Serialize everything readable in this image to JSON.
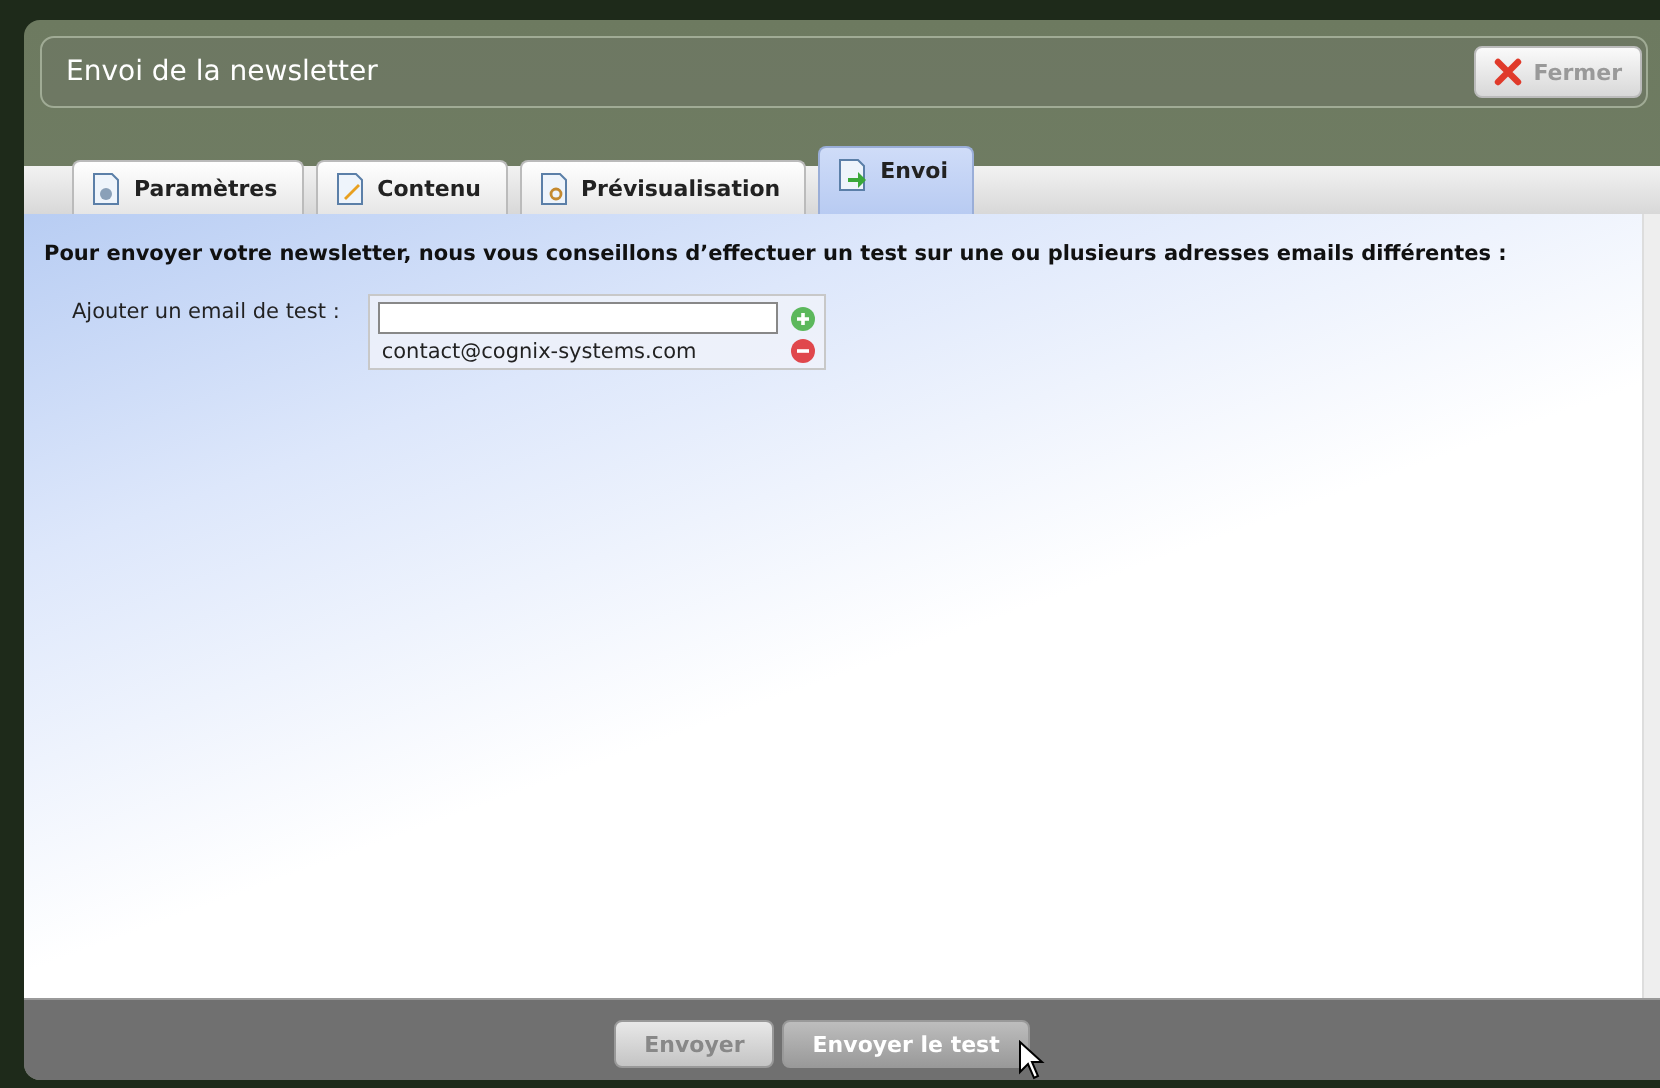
{
  "window": {
    "title": "Envoi de la newsletter",
    "close_button": "Fermer"
  },
  "tabs": [
    {
      "label": "Paramètres",
      "selected": false,
      "kind": "settings"
    },
    {
      "label": "Contenu",
      "selected": false,
      "kind": "edit"
    },
    {
      "label": "Prévisualisation",
      "selected": false,
      "kind": "preview"
    },
    {
      "label": "Envoi",
      "selected": true,
      "kind": "send"
    }
  ],
  "intro": "Pour envoyer votre newsletter, nous vous conseillons d’effectuer un test sur une ou plusieurs adresses emails différentes :",
  "test_email": {
    "label": "Ajouter un email de test :",
    "emails": [
      "contact@cognix-systems.com"
    ]
  },
  "buttons": [
    {
      "label": "Envoyer",
      "hovered": false
    },
    {
      "label": "Envoyer le test",
      "hovered": true
    }
  ]
}
